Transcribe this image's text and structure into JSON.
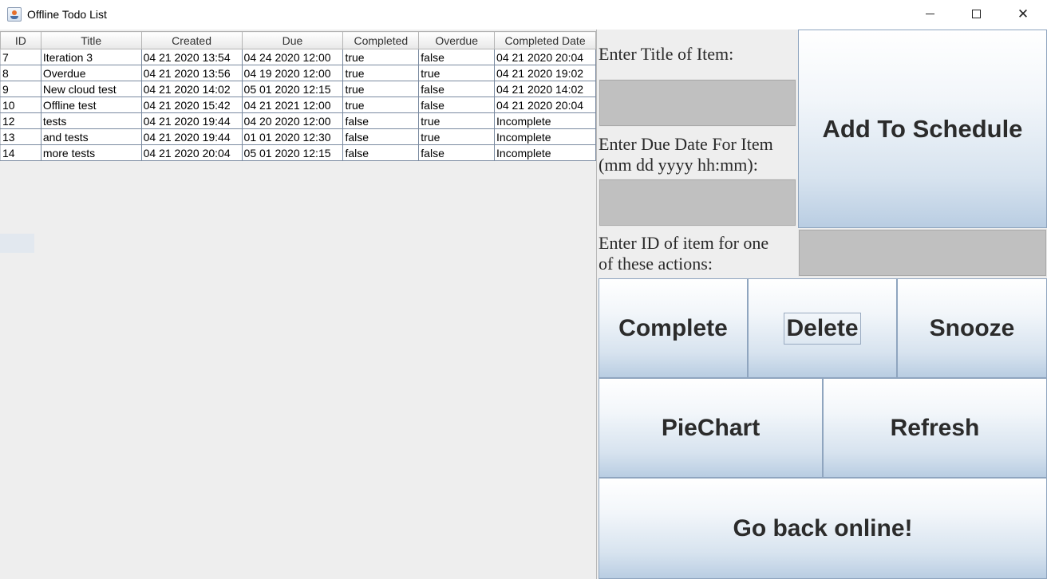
{
  "window": {
    "title": "Offline Todo List"
  },
  "table": {
    "columns": [
      "ID",
      "Title",
      "Created",
      "Due",
      "Completed",
      "Overdue",
      "Completed Date"
    ],
    "rows": [
      [
        "7",
        "Iteration 3",
        "04 21 2020 13:54",
        "04 24 2020 12:00",
        "true",
        "false",
        "04 21 2020 20:04"
      ],
      [
        "8",
        "Overdue",
        "04 21 2020 13:56",
        "04 19 2020 12:00",
        "true",
        "true",
        "04 21 2020 19:02"
      ],
      [
        "9",
        "New cloud test",
        "04 21 2020 14:02",
        "05 01 2020 12:15",
        "true",
        "false",
        "04 21 2020 14:02"
      ],
      [
        "10",
        "Offline test",
        "04 21 2020 15:42",
        "04 21 2021 12:00",
        "true",
        "false",
        "04 21 2020 20:04"
      ],
      [
        "12",
        "tests",
        "04 21 2020 19:44",
        "04 20 2020 12:00",
        "false",
        "true",
        "Incomplete"
      ],
      [
        "13",
        "and tests",
        "04 21 2020 19:44",
        "01 01 2020 12:30",
        "false",
        "true",
        "Incomplete"
      ],
      [
        "14",
        "more tests",
        "04 21 2020 20:04",
        "05 01 2020 12:15",
        "false",
        "false",
        "Incomplete"
      ]
    ]
  },
  "form": {
    "title_label": "Enter Title of Item:",
    "due_label_line1": "Enter Due Date For Item",
    "due_label_line2": "(mm dd yyyy hh:mm):",
    "id_label_line1": "Enter ID of item for one",
    "id_label_line2": "of these actions:",
    "title_value": "",
    "due_value": "",
    "id_value": ""
  },
  "buttons": {
    "add": "Add To Schedule",
    "complete": "Complete",
    "delete": "Delete",
    "snooze": "Snooze",
    "piechart": "PieChart",
    "refresh": "Refresh",
    "online": "Go back online!"
  },
  "colors": {
    "button_top": "#ffffff",
    "button_bottom": "#b9cde2",
    "field": "#c0c0c0",
    "panel": "#eeeeee"
  }
}
